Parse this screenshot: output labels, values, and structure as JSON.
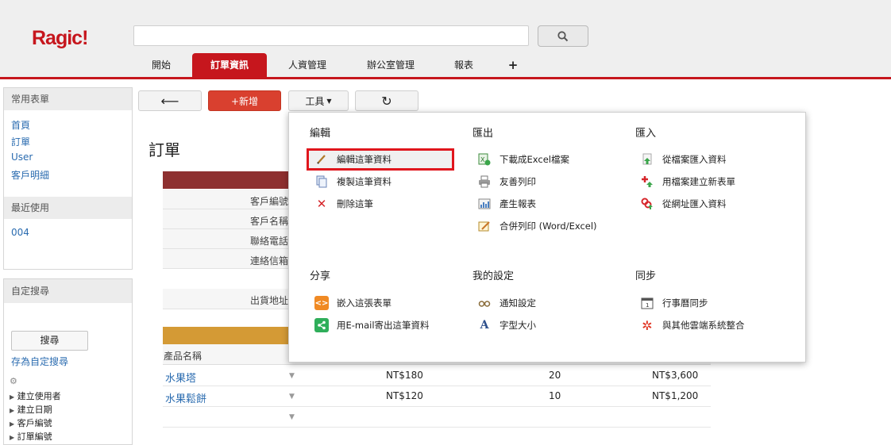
{
  "app": {
    "logo": "Ragic!"
  },
  "header": {
    "search_placeholder": "",
    "tabs": [
      "開始",
      "訂單資訊",
      "人資管理",
      "辦公室管理",
      "報表",
      "+"
    ],
    "active_tab": "訂單資訊"
  },
  "sidebar": {
    "favorites": {
      "title": "常用表單",
      "items": [
        "首頁",
        "訂單",
        "User",
        "客戶明細"
      ]
    },
    "recent": {
      "title": "最近使用",
      "items": [
        "004"
      ]
    },
    "custom_search": {
      "title": "自定搜尋",
      "search_button": "搜尋",
      "save_link": "存為自定搜尋",
      "fields": [
        "建立使用者",
        "建立日期",
        "客戶編號",
        "訂單編號"
      ]
    }
  },
  "toolbar": {
    "back": "⟵",
    "new": "+新增",
    "tools": "工具",
    "refresh": "↻"
  },
  "page": {
    "title": "訂單",
    "fields": [
      "客戶編號",
      "客戶名稱",
      "聯絡電話",
      "連絡信箱",
      "出貨地址"
    ],
    "subtable_header": "產品名稱",
    "rows": [
      {
        "name": "水果塔",
        "price": "NT$180",
        "qty": "20",
        "total": "NT$3,600"
      },
      {
        "name": "水果鬆餅",
        "price": "NT$120",
        "qty": "10",
        "total": "NT$1,200"
      }
    ]
  },
  "menu": {
    "edit": {
      "title": "編輯",
      "items": [
        "編輯這筆資料",
        "複製這筆資料",
        "刪除這筆"
      ]
    },
    "export": {
      "title": "匯出",
      "items": [
        "下載成Excel檔案",
        "友善列印",
        "產生報表",
        "合併列印 (Word/Excel)"
      ]
    },
    "import": {
      "title": "匯入",
      "items": [
        "從檔案匯入資料",
        "用檔案建立新表單",
        "從網址匯入資料"
      ]
    },
    "share": {
      "title": "分享",
      "items": [
        "嵌入這張表單",
        "用E-mail寄出這筆資料"
      ]
    },
    "settings": {
      "title": "我的設定",
      "items": [
        "通知設定",
        "字型大小"
      ]
    },
    "sync": {
      "title": "同步",
      "items": [
        "行事曆同步",
        "與其他雲端系統整合"
      ]
    }
  },
  "colors": {
    "brand": "#c6161d",
    "new_button": "#d9402f",
    "form_header": "#8e3030",
    "subtable_header": "#d49a35",
    "link": "#2b6cb0"
  }
}
